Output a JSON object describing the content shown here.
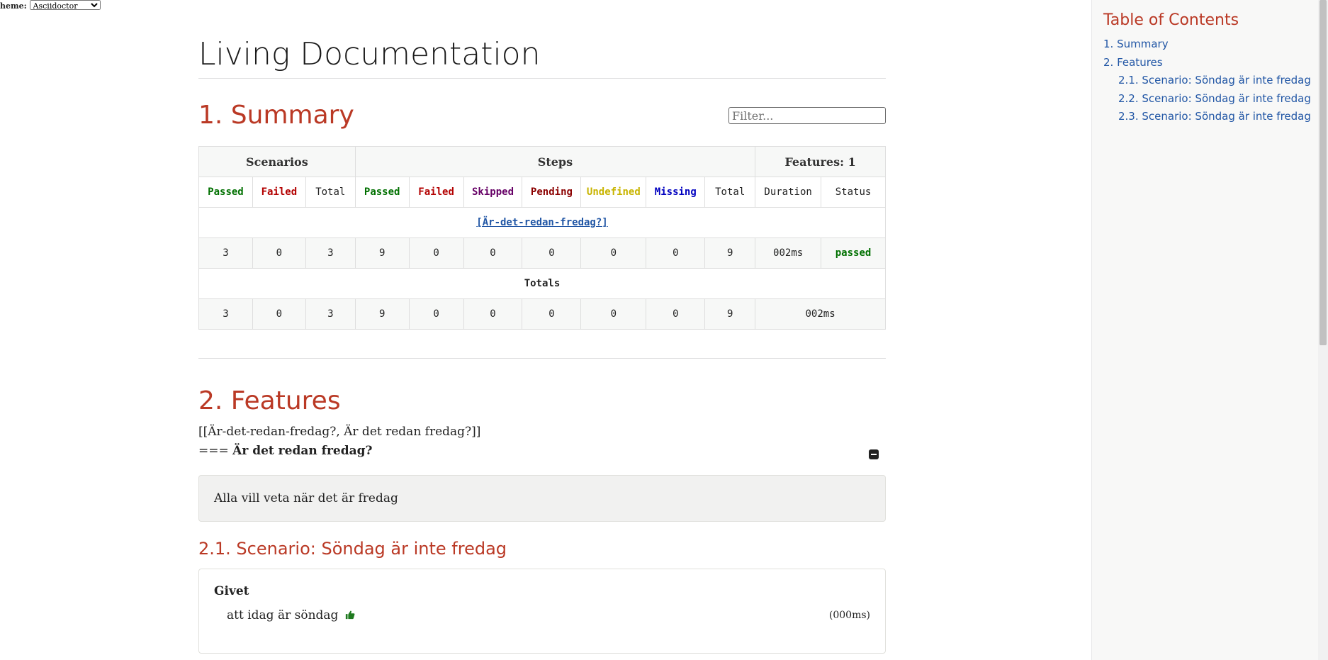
{
  "theme": {
    "label": "heme:",
    "selected": "Asciidoctor"
  },
  "doc_title": "Living Documentation",
  "summary": {
    "heading": "1. Summary",
    "filter_placeholder": "Filter...",
    "header_groups": {
      "scenarios": "Scenarios",
      "steps": "Steps",
      "features": "Features: 1"
    },
    "columns": {
      "sc_passed": "Passed",
      "sc_failed": "Failed",
      "sc_total": "Total",
      "st_passed": "Passed",
      "st_failed": "Failed",
      "st_skipped": "Skipped",
      "st_pending": "Pending",
      "st_undefined": "Undefined",
      "st_missing": "Missing",
      "st_total": "Total",
      "duration": "Duration",
      "status": "Status"
    },
    "feature_link": "[Är-det-redan-fredag?]",
    "row": {
      "sc_passed": "3",
      "sc_failed": "0",
      "sc_total": "3",
      "st_passed": "9",
      "st_failed": "0",
      "st_skipped": "0",
      "st_pending": "0",
      "st_undefined": "0",
      "st_missing": "0",
      "st_total": "9",
      "duration": "002ms",
      "status": "passed"
    },
    "totals_label": "Totals",
    "totals": {
      "sc_passed": "3",
      "sc_failed": "0",
      "sc_total": "3",
      "st_passed": "9",
      "st_failed": "0",
      "st_skipped": "0",
      "st_pending": "0",
      "st_undefined": "0",
      "st_missing": "0",
      "st_total": "9",
      "duration": "002ms"
    }
  },
  "features": {
    "heading": "2. Features",
    "anchor_text": "[[Är-det-redan-fredag?, Är det redan fredag?]]",
    "title_prefix": "===",
    "title": "Är det redan fredag?",
    "description": "Alla vill veta när det är fredag",
    "scenario": {
      "heading": "2.1. Scenario: Söndag är inte fredag",
      "keyword": "Givet",
      "step": "att idag är söndag",
      "duration": "(000ms)"
    }
  },
  "toc": {
    "title": "Table of Contents",
    "items": [
      {
        "label": "1. Summary"
      },
      {
        "label": "2. Features"
      },
      {
        "label": "2.1. Scenario: Söndag är inte fredag"
      },
      {
        "label": "2.2. Scenario: Söndag är inte fredag"
      },
      {
        "label": "2.3. Scenario: Söndag är inte fredag"
      }
    ]
  }
}
